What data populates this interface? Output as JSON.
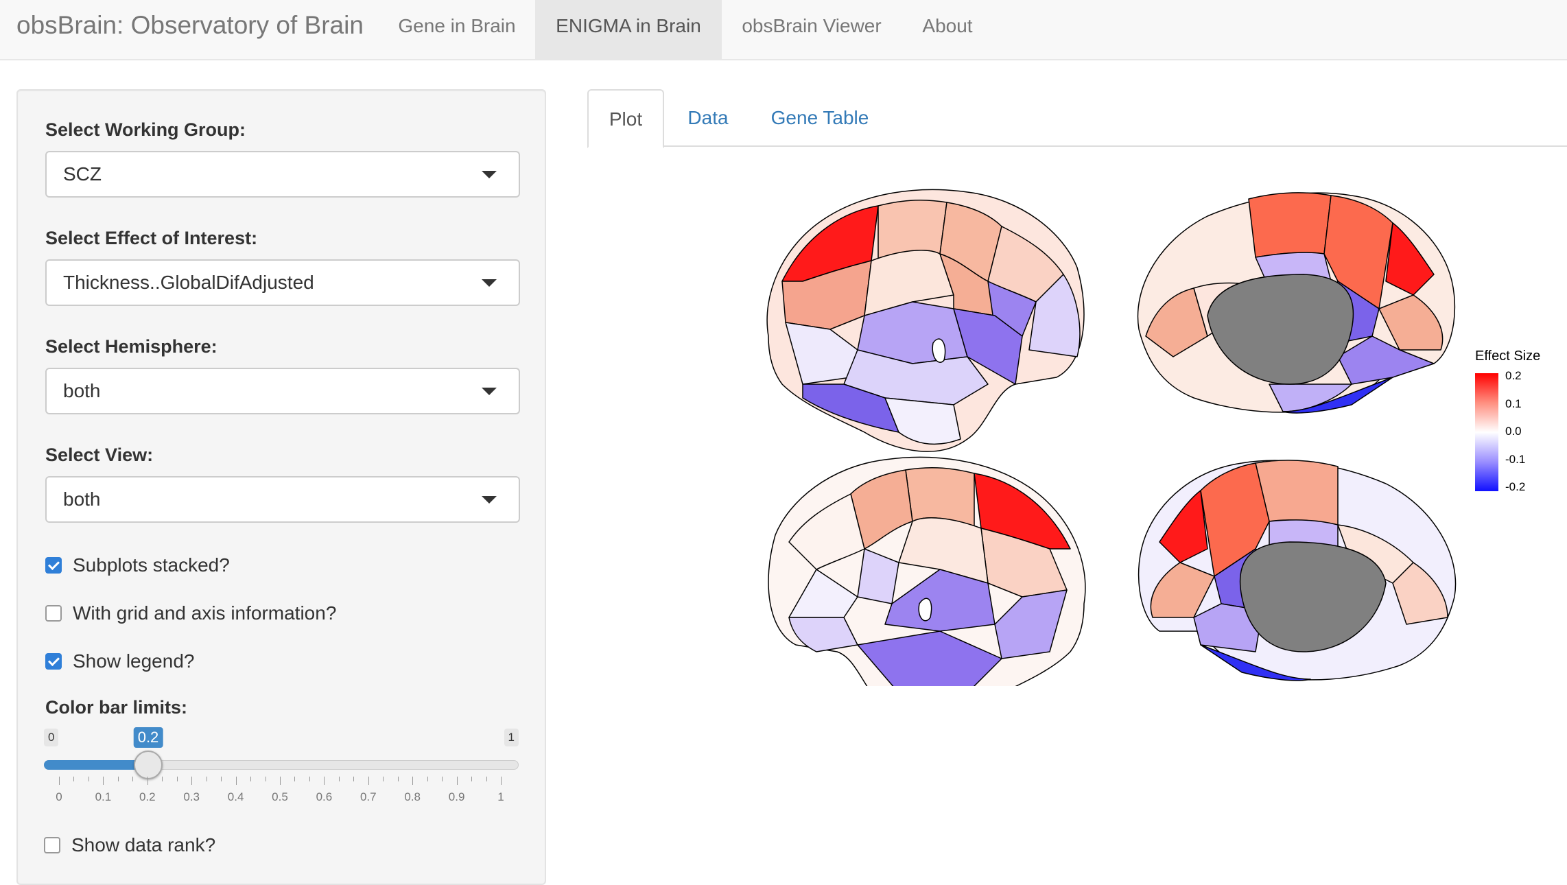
{
  "navbar": {
    "brand": "obsBrain: Observatory of Brain",
    "items": [
      {
        "label": "Gene in Brain",
        "active": false
      },
      {
        "label": "ENIGMA in Brain",
        "active": true
      },
      {
        "label": "obsBrain Viewer",
        "active": false
      },
      {
        "label": "About",
        "active": false
      }
    ]
  },
  "sidebar": {
    "working_group": {
      "label": "Select Working Group:",
      "value": "SCZ"
    },
    "effect": {
      "label": "Select Effect of Interest:",
      "value": "Thickness..GlobalDifAdjusted"
    },
    "hemisphere": {
      "label": "Select Hemisphere:",
      "value": "both"
    },
    "view": {
      "label": "Select View:",
      "value": "both"
    },
    "checkboxes": [
      {
        "label": "Subplots stacked?",
        "checked": true
      },
      {
        "label": "With grid and axis information?",
        "checked": false
      },
      {
        "label": "Show legend?",
        "checked": true
      }
    ],
    "slider": {
      "label": "Color bar limits:",
      "min": "0",
      "max": "1",
      "value": "0.2",
      "ticks": [
        "0",
        "0.1",
        "0.2",
        "0.3",
        "0.4",
        "0.5",
        "0.6",
        "0.7",
        "0.8",
        "0.9",
        "1"
      ]
    },
    "data_rank": {
      "label": "Show data rank?",
      "checked": false
    }
  },
  "tabs": [
    {
      "label": "Plot",
      "active": true
    },
    {
      "label": "Data",
      "active": false
    },
    {
      "label": "Gene Table",
      "active": false
    }
  ],
  "legend": {
    "title": "Effect Size",
    "labels": [
      "0.2",
      "0.1",
      "0.0",
      "-0.1",
      "-0.2"
    ],
    "colors": {
      "high": "#ff0000",
      "mid": "#ffffff",
      "low": "#1010ff"
    }
  }
}
